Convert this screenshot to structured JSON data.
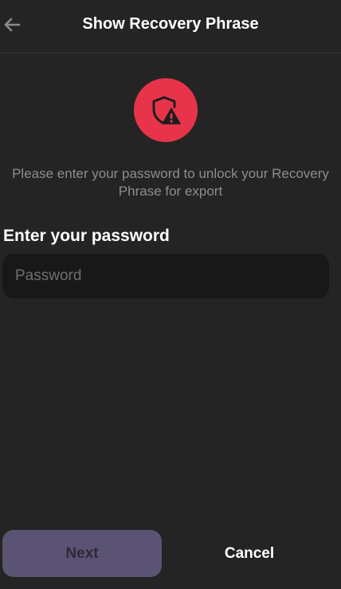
{
  "header": {
    "title": "Show Recovery Phrase",
    "back_icon": "arrow-left-icon"
  },
  "alert": {
    "icon": "shield-warning-icon",
    "color": "#e8344a",
    "description": "Please enter your password to unlock your Recovery Phrase for export"
  },
  "password": {
    "label": "Enter your password",
    "placeholder": "Password",
    "value": ""
  },
  "actions": {
    "next_label": "Next",
    "cancel_label": "Cancel",
    "next_color": "#5b5373"
  }
}
